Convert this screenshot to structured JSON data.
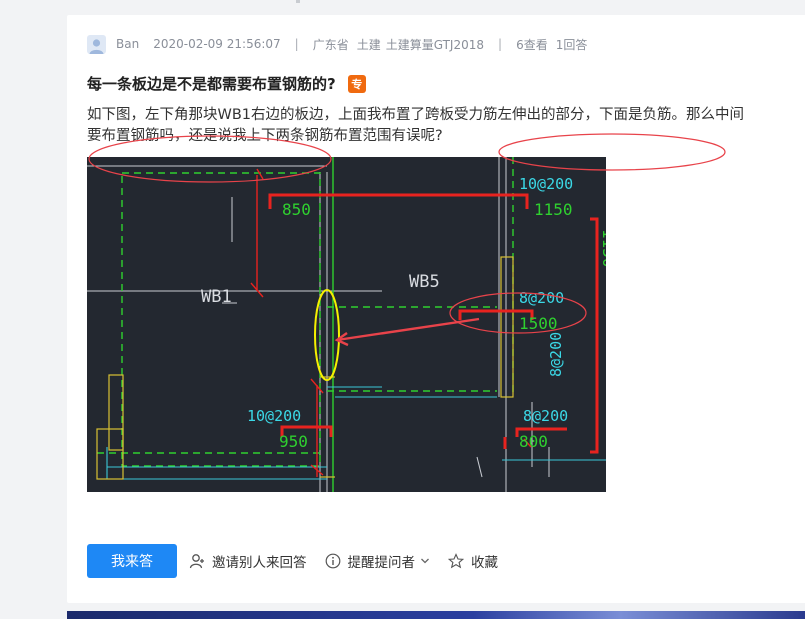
{
  "question": {
    "author": "Ban",
    "datetime": "2020-02-09 21:56:07",
    "separator": "|",
    "region": "广东省",
    "category": "土建",
    "software": "土建算量GTJ2018",
    "views": "6查看",
    "answers": "1回答",
    "title": "每一条板边是不是都需要布置钢筋的?",
    "badge": "专",
    "body_line1": "如下图，左下角那块WB1右边的板边，上面我布置了跨板受力筋左伸出的部分，下面是负筋。那么中间",
    "body_line2": "要布置钢筋吗，还是说我上下两条钢筋布置范围有误呢?"
  },
  "drawing": {
    "labels": {
      "wb1": "WB1",
      "wb5": "WB5",
      "top_rebar": "10@200",
      "top_len_left": "850",
      "top_len_right": "1150",
      "vert_len": "1150",
      "mid_rebar": "8@200",
      "mid_len": "1500",
      "vert_rebar": "8@200",
      "low_rebar_left": "10@200",
      "low_len_left": "950",
      "low_rebar_right": "8@200",
      "low_len_right": "800"
    }
  },
  "actions": {
    "answer": "我来答",
    "invite": "邀请别人来回答",
    "remind": "提醒提问者",
    "favorite": "收藏"
  },
  "colors": {
    "primary": "#1e88f5",
    "badge": "#f06a0f",
    "cad_bg": "#232830"
  }
}
